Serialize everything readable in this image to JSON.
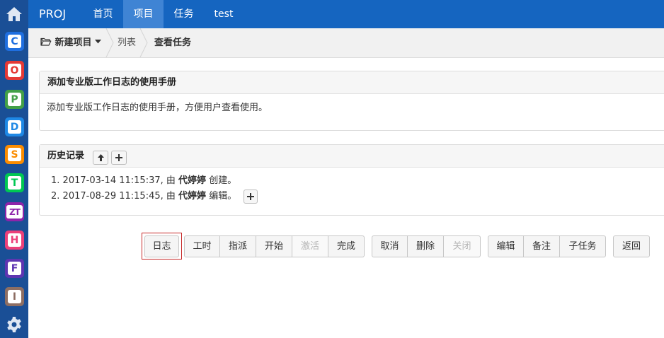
{
  "appbar": {
    "home_icon": "home-icon",
    "apps": [
      {
        "name": "app-c",
        "letter": "C",
        "color": "#1f6fe0"
      },
      {
        "name": "app-o",
        "letter": "O",
        "color": "#e53935"
      },
      {
        "name": "app-p",
        "letter": "P",
        "color": "#43a047"
      },
      {
        "name": "app-d",
        "letter": "D",
        "color": "#1e88e5"
      },
      {
        "name": "app-s",
        "letter": "S",
        "color": "#fb8c00"
      },
      {
        "name": "app-t",
        "letter": "T",
        "color": "#00c853"
      },
      {
        "name": "app-zt",
        "letter": "ZT",
        "color": "#8e24aa"
      },
      {
        "name": "app-h",
        "letter": "H",
        "color": "#ec407a"
      },
      {
        "name": "app-f",
        "letter": "F",
        "color": "#5e35b1"
      },
      {
        "name": "app-i",
        "letter": "I",
        "color": "#8d6e63"
      }
    ],
    "settings_icon": "gear-icon"
  },
  "navbar": {
    "brand": "PROJ",
    "items": [
      {
        "label": "首页",
        "active": false
      },
      {
        "label": "项目",
        "active": true
      },
      {
        "label": "任务",
        "active": false
      },
      {
        "label": "test",
        "active": false
      }
    ],
    "color": "#1565c0"
  },
  "breadcrumb": {
    "project_menu": "新建项目",
    "list": "列表",
    "current": "查看任务"
  },
  "description_panel": {
    "title": "添加专业版工作日志的使用手册",
    "body": "添加专业版工作日志的使用手册，方便用户查看使用。"
  },
  "history_panel": {
    "title": "历史记录",
    "entries": [
      {
        "num": "1.",
        "time": "2017-03-14 11:15:37, 由",
        "user": "代婷婷",
        "action": "创建。"
      },
      {
        "num": "2.",
        "time": "2017-08-29 11:15:45, 由",
        "user": "代婷婷",
        "action": "编辑。"
      }
    ]
  },
  "actions": {
    "group1": [
      "日志"
    ],
    "group2": [
      {
        "label": "工时",
        "disabled": false
      },
      {
        "label": "指派",
        "disabled": false
      },
      {
        "label": "开始",
        "disabled": false
      },
      {
        "label": "激活",
        "disabled": true
      },
      {
        "label": "完成",
        "disabled": false
      }
    ],
    "group3": [
      {
        "label": "取消",
        "disabled": false
      },
      {
        "label": "删除",
        "disabled": false
      },
      {
        "label": "关闭",
        "disabled": true
      }
    ],
    "group4": [
      {
        "label": "编辑",
        "disabled": false
      },
      {
        "label": "备注",
        "disabled": false
      },
      {
        "label": "子任务",
        "disabled": false
      }
    ],
    "back": "返回"
  }
}
